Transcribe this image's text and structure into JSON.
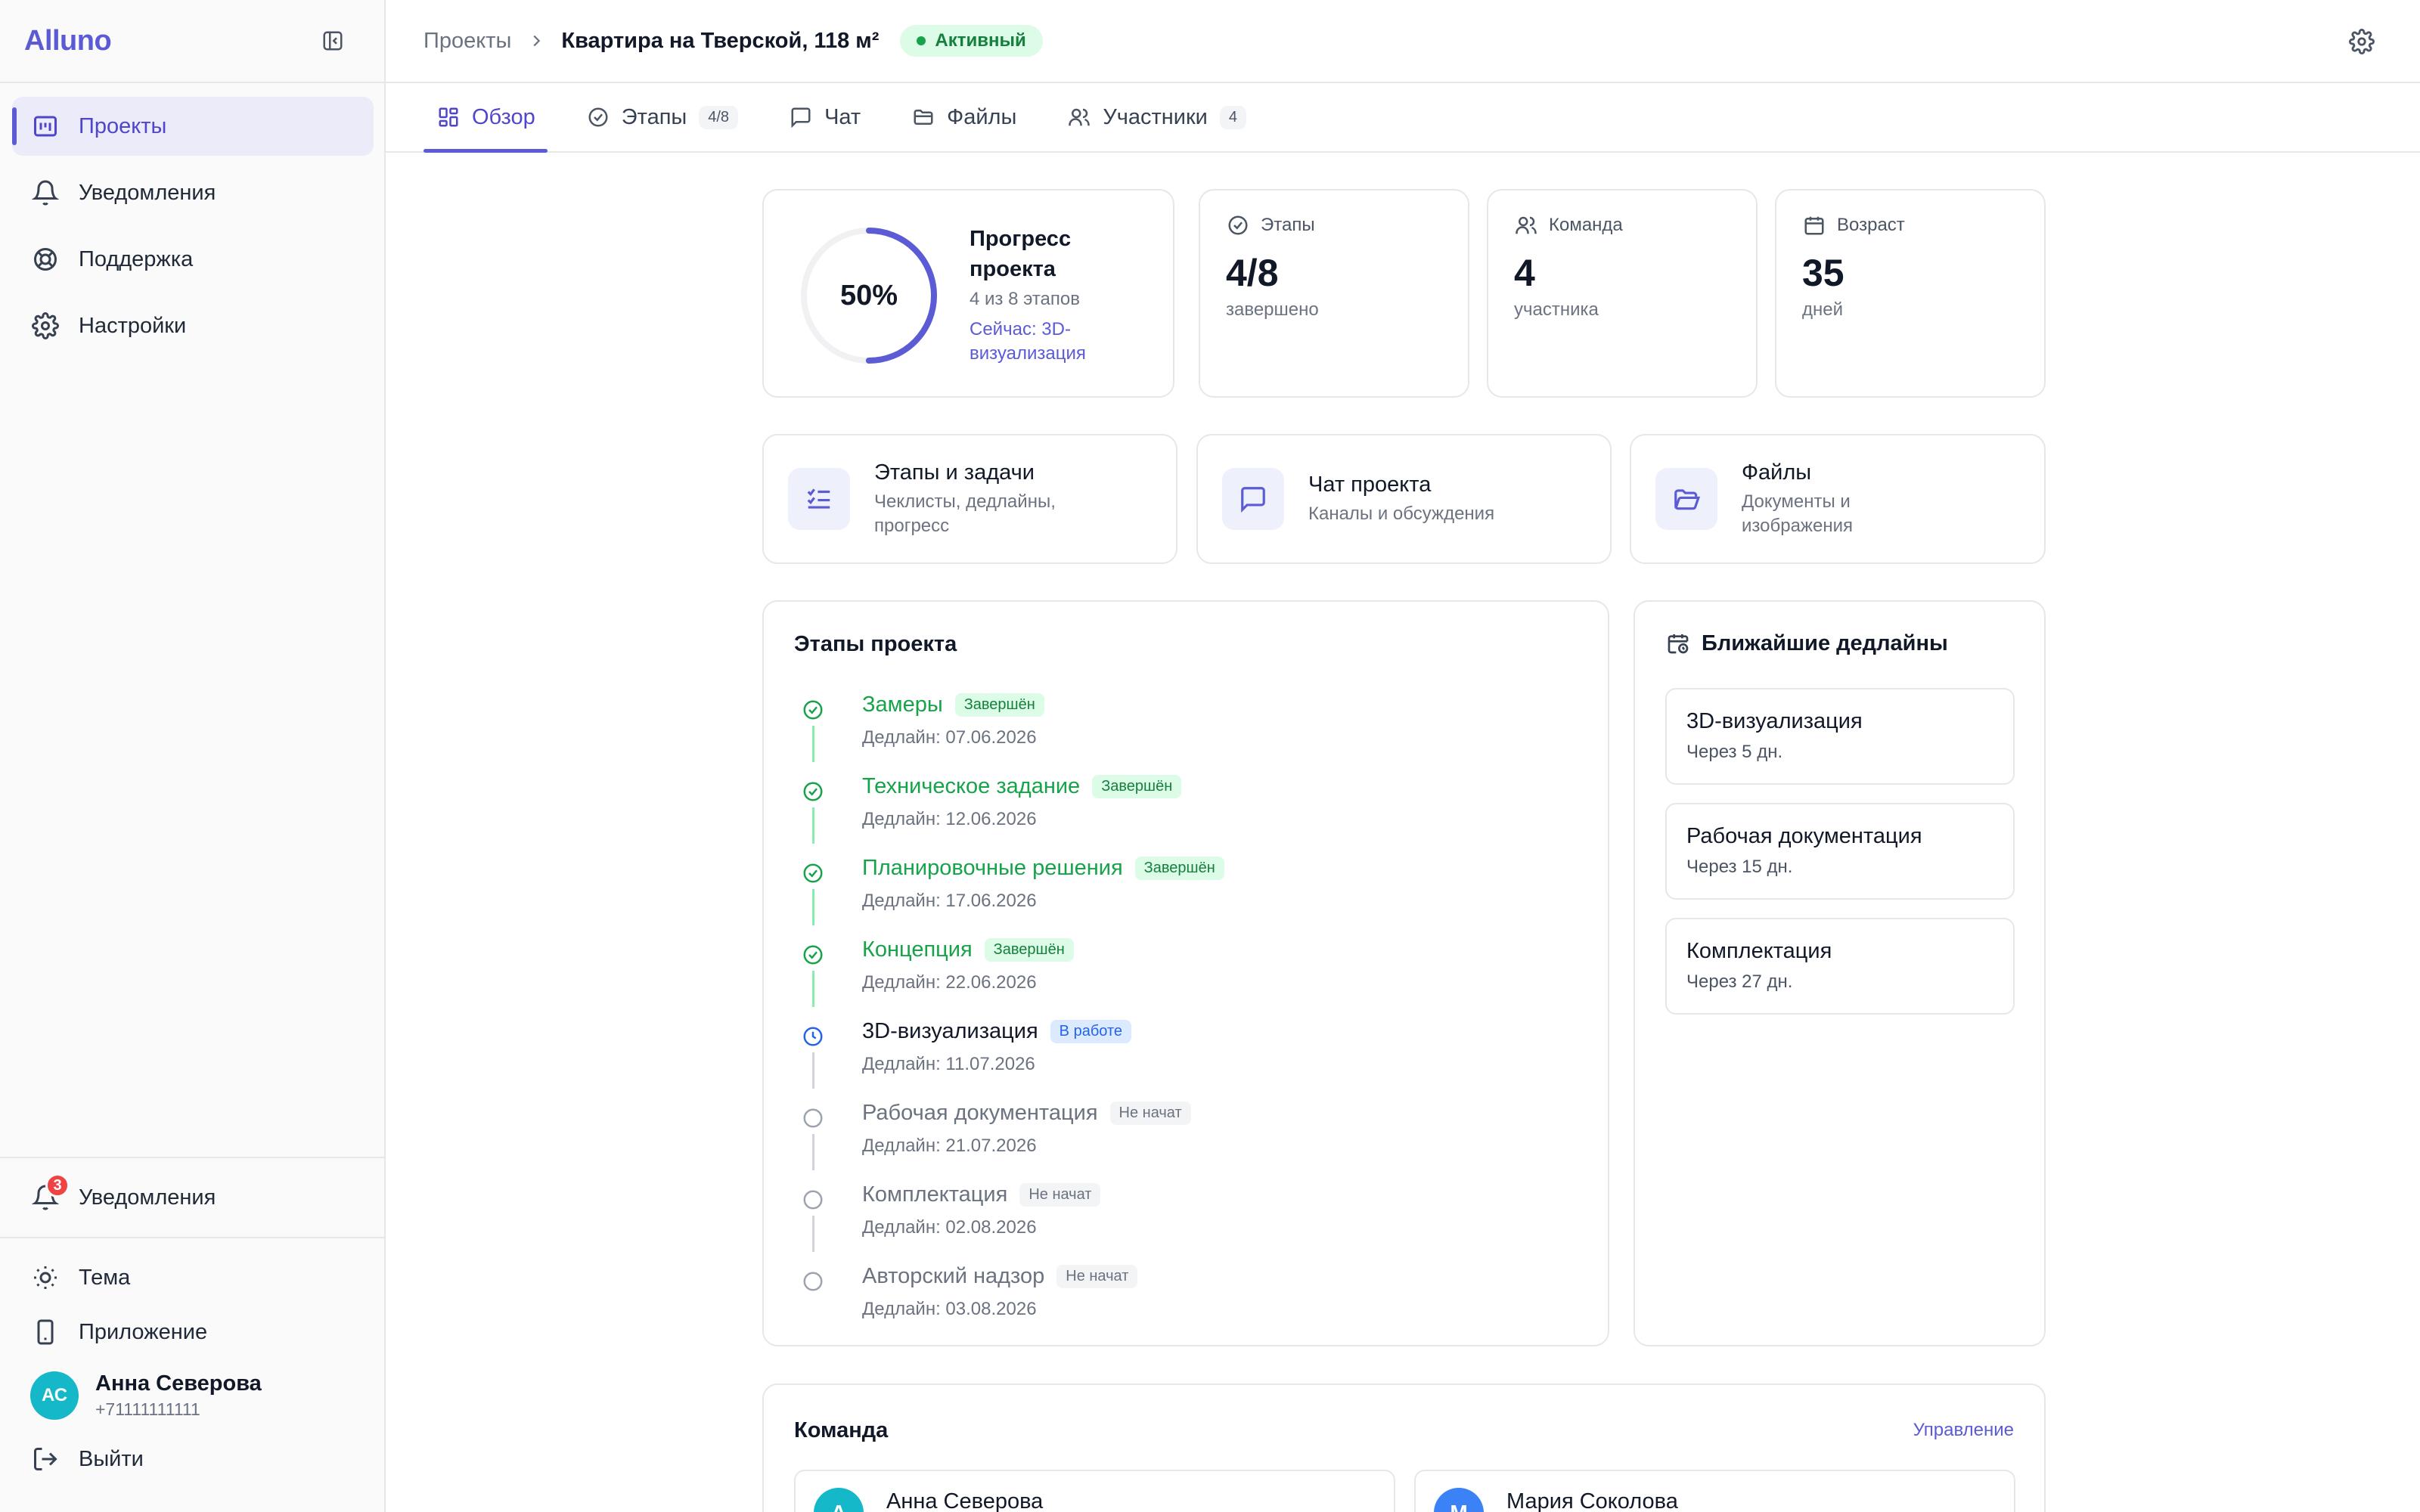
{
  "app": {
    "brand": "Alluno"
  },
  "sidebar": {
    "nav": [
      {
        "label": "Проекты",
        "icon": "projects-icon",
        "active": true
      },
      {
        "label": "Уведомления",
        "icon": "bell-icon"
      },
      {
        "label": "Поддержка",
        "icon": "lifebuoy-icon"
      },
      {
        "label": "Настройки",
        "icon": "gear-icon"
      }
    ],
    "notifications": {
      "label": "Уведомления",
      "count": "3"
    },
    "theme_label": "Тема",
    "app_label": "Приложение",
    "user": {
      "initials": "АС",
      "name": "Анна Северова",
      "phone": "+71111111111"
    },
    "logout_label": "Выйти"
  },
  "header": {
    "breadcrumb_root": "Проекты",
    "title": "Квартира на Тверской, 118 м²",
    "status": "Активный"
  },
  "tabs": [
    {
      "label": "Обзор",
      "count": "",
      "active": true
    },
    {
      "label": "Этапы",
      "count": "4/8"
    },
    {
      "label": "Чат",
      "count": ""
    },
    {
      "label": "Файлы",
      "count": ""
    },
    {
      "label": "Участники",
      "count": "4"
    }
  ],
  "progress": {
    "percent": 50,
    "percent_label": "50%",
    "title": "Прогресс проекта",
    "subtitle": "4 из 8 этапов",
    "current": "Сейчас: 3D-визуализация"
  },
  "stats": [
    {
      "label": "Этапы",
      "value": "4/8",
      "unit": "завершено"
    },
    {
      "label": "Команда",
      "value": "4",
      "unit": "участника"
    },
    {
      "label": "Возраст",
      "value": "35",
      "unit": "дней"
    }
  ],
  "quick_links": [
    {
      "title": "Этапы и задачи",
      "subtitle": "Чеклисты, дедлайны, прогресс"
    },
    {
      "title": "Чат проекта",
      "subtitle": "Каналы и обсуждения"
    },
    {
      "title": "Файлы",
      "subtitle": "Документы и изображения"
    }
  ],
  "stages": {
    "title": "Этапы проекта",
    "items": [
      {
        "name": "Замеры",
        "status": "done",
        "tag": "Завершён",
        "deadline": "Дедлайн: 07.06.2026"
      },
      {
        "name": "Техническое задание",
        "status": "done",
        "tag": "Завершён",
        "deadline": "Дедлайн: 12.06.2026"
      },
      {
        "name": "Планировочные решения",
        "status": "done",
        "tag": "Завершён",
        "deadline": "Дедлайн: 17.06.2026"
      },
      {
        "name": "Концепция",
        "status": "done",
        "tag": "Завершён",
        "deadline": "Дедлайн: 22.06.2026"
      },
      {
        "name": "3D-визуализация",
        "status": "work",
        "tag": "В работе",
        "deadline": "Дедлайн: 11.07.2026"
      },
      {
        "name": "Рабочая документация",
        "status": "todo",
        "tag": "Не начат",
        "deadline": "Дедлайн: 21.07.2026"
      },
      {
        "name": "Комплектация",
        "status": "todo",
        "tag": "Не начат",
        "deadline": "Дедлайн: 02.08.2026"
      },
      {
        "name": "Авторский надзор",
        "status": "todo",
        "tag": "Не начат",
        "deadline": "Дедлайн: 03.08.2026"
      }
    ]
  },
  "deadlines": {
    "title": "Ближайшие дедлайны",
    "items": [
      {
        "name": "3D-визуализация",
        "when": "Через 5 дн."
      },
      {
        "name": "Рабочая документация",
        "when": "Через 15 дн."
      },
      {
        "name": "Комплектация",
        "when": "Через 27 дн."
      }
    ]
  },
  "team": {
    "title": "Команда",
    "manage_label": "Управление",
    "members": [
      {
        "initial": "А",
        "name": "Анна Северова",
        "color": "#14b8c8"
      },
      {
        "initial": "М",
        "name": "Мария Соколова",
        "color": "#3b82f6"
      }
    ]
  },
  "colors": {
    "accent": "#5b5bd6",
    "success": "#16a34a",
    "info": "#2563eb",
    "muted": "#9ca3af"
  }
}
